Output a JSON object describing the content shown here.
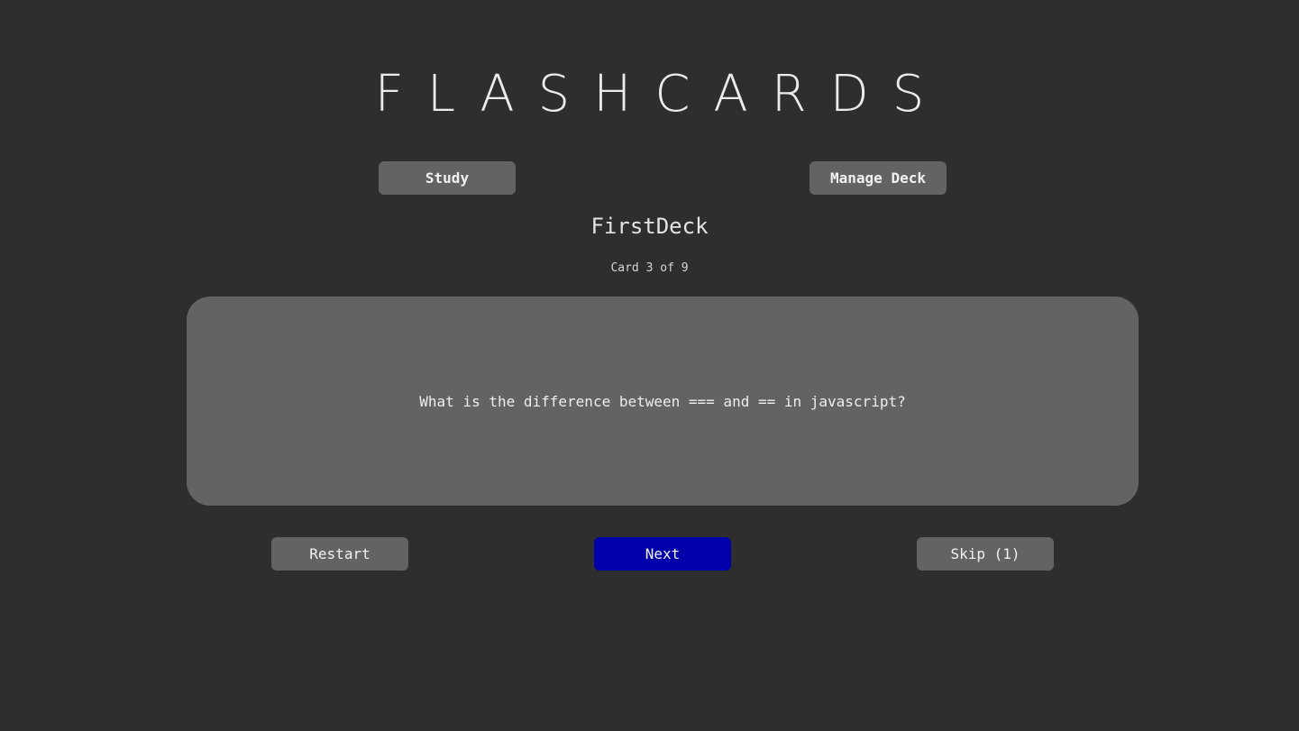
{
  "app": {
    "title": "FLASHCARDS"
  },
  "nav": {
    "study_label": "Study",
    "manage_label": "Manage Deck"
  },
  "deck": {
    "name": "FirstDeck",
    "progress_text": "Card 3 of 9",
    "current_card": 3,
    "total_cards": 9
  },
  "card": {
    "question": "What is the difference between === and == in javascript?"
  },
  "controls": {
    "restart_label": "Restart",
    "next_label": "Next",
    "skip_label": "Skip (1)"
  },
  "colors": {
    "background": "#2e2e2e",
    "surface": "#636363",
    "accent": "#0000aa",
    "text": "#eeeeee"
  }
}
